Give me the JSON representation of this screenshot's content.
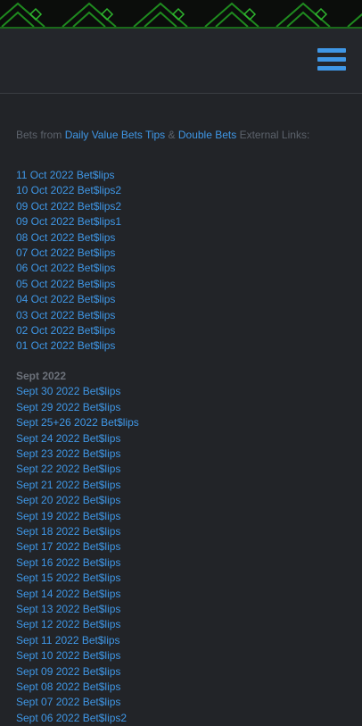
{
  "header": {
    "menu_icon": "hamburger-menu-icon",
    "accent": "#3f97e6"
  },
  "intro": {
    "prefix": "Bets from ",
    "link1": "Daily Value Bets Tips",
    "amp": " & ",
    "link2": "Double Bets",
    "suffix": " External Links:"
  },
  "oct_links": [
    "11 Oct 2022 Bet$lips",
    "10 Oct 2022 Bet$lips2",
    "09 Oct 2022 Bet$lips2",
    "09 Oct 2022 Bet$lips1",
    "08 Oct 2022 Bet$lips",
    "07 Oct 2022 Bet$lips",
    "06 Oct 2022 Bet$lips",
    "05 Oct 2022 Bet$lips",
    "04 Oct 2022 Bet$lips",
    "03 Oct 2022 Bet$lips",
    "02 Oct 2022 Bet$lips",
    "01 Oct 2022 Bet$lips"
  ],
  "sept_title": "Sept 2022",
  "sept_links": [
    "Sept 30 2022 Bet$lips",
    "Sept 29 2022 Bet$lips",
    "Sept 25+26 2022 Bet$lips",
    "Sept 24 2022 Bet$lips",
    "Sept 23 2022 Bet$lips",
    "Sept 22 2022 Bet$lips",
    "Sept 21 2022 Bet$lips",
    "Sept 20 2022 Bet$lips",
    "Sept 19 2022 Bet$lips",
    "Sept 18 2022 Bet$lips",
    "Sept 17 2022 Bet$lips",
    "Sept 16 2022 Bet$lips",
    "Sept 15 2022 Bet$lips",
    "Sept 14 2022 Bet$lips",
    "Sept 13 2022 Bet$lips",
    "Sept 12 2022 Bet$lips",
    "Sept 11 2022 Bet$lips",
    "Sept 10 2022 Bet$lips",
    "Sept 09 2022 Bet$lips",
    "Sept 08 2022 Bet$lips",
    "Sept 07 2022 Bet$lips",
    "Sept 06 2022 Bet$lips2"
  ]
}
